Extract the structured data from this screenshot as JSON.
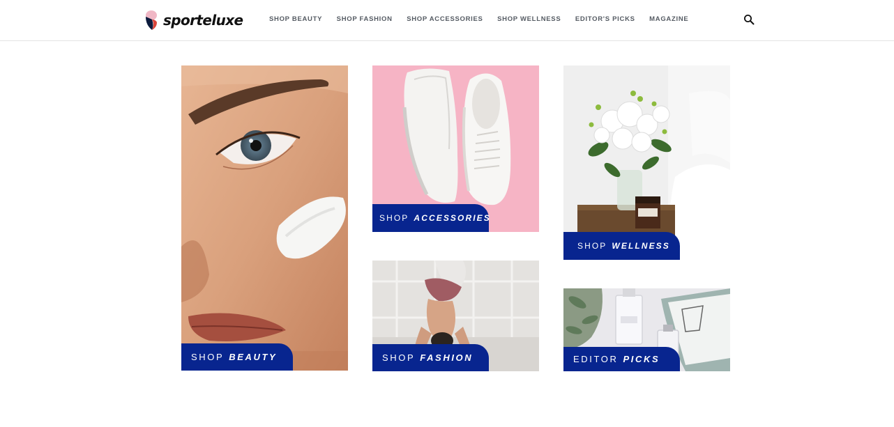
{
  "brand": {
    "name": "sporteluxe"
  },
  "nav": {
    "items": [
      {
        "label": "SHOP BEAUTY"
      },
      {
        "label": "SHOP FASHION"
      },
      {
        "label": "SHOP ACCESSORIES"
      },
      {
        "label": "SHOP WELLNESS"
      },
      {
        "label": "EDITOR'S PICKS"
      },
      {
        "label": "MAGAZINE"
      }
    ],
    "search_icon": "search-icon"
  },
  "tiles": {
    "beauty": {
      "prefix": "SHOP",
      "word": "BEAUTY",
      "image": "face-with-cream-photo"
    },
    "accessories": {
      "prefix": "SHOP",
      "word": "ACCESSORIES",
      "image": "white-sneakers-on-pink-photo"
    },
    "fashion": {
      "prefix": "SHOP",
      "word": "FASHION",
      "image": "yoga-headstand-photo"
    },
    "wellness": {
      "prefix": "SHOP",
      "word": "WELLNESS",
      "image": "flowers-and-candle-photo"
    },
    "editor": {
      "prefix": "EDITOR",
      "word": "PICKS",
      "image": "perfume-and-book-photo"
    }
  },
  "colors": {
    "label_bg": "#08258f",
    "nav_text": "#555b63",
    "accessories_bg": "#f6b4c5"
  }
}
